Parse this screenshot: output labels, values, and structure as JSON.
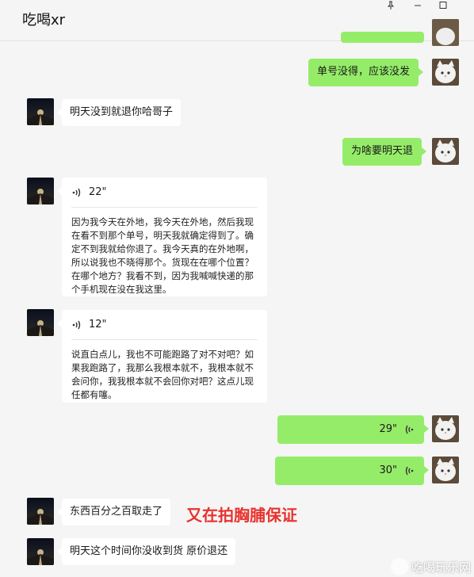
{
  "window": {
    "title": "吃喝xr"
  },
  "titlebar_icons": {
    "pin": "pin-icon",
    "minimize": "minimize-icon",
    "maximize": "maximize-icon"
  },
  "messages": [
    {
      "side": "right",
      "type": "text",
      "text": "单号没得，应该没发"
    },
    {
      "side": "left",
      "type": "text",
      "text": "明天没到就退你哈哥子"
    },
    {
      "side": "right",
      "type": "text",
      "text": "为啥要明天退"
    },
    {
      "side": "left",
      "type": "voice",
      "duration": "22\"",
      "transcript": "因为我今天在外地，我今天在外地，然后我现在看不到那个单号，明天我就确定得到了。确定不到我就给你退了。我今天真的在外地啊，所以说我也不晓得那个。货现在在哪个位置？在哪个地方？我看不到，因为我喊喊快递的那个手机现在没在我这里。"
    },
    {
      "side": "left",
      "type": "voice",
      "duration": "12\"",
      "transcript": "说直白点儿，我也不可能跑路了对不对吧？如果我跑路了，我那么我根本就不，我根本就不会问你，我我根本就不会回你对吧？这点儿现任都有噻。"
    },
    {
      "side": "right",
      "type": "voice",
      "duration": "29\""
    },
    {
      "side": "right",
      "type": "voice",
      "duration": "30\""
    },
    {
      "side": "left",
      "type": "text",
      "text": "东西百分之百取走了"
    },
    {
      "side": "left",
      "type": "text",
      "text": "明天这个时间你没收到货 原价退还"
    }
  ],
  "annotation": {
    "text": "又在拍胸脯保证",
    "color": "#e8322e"
  },
  "watermark": {
    "text": "吃喝玩乐网"
  },
  "colors": {
    "sent_bubble": "#95ec69",
    "received_bubble": "#ffffff",
    "background": "#f5f5f5"
  }
}
